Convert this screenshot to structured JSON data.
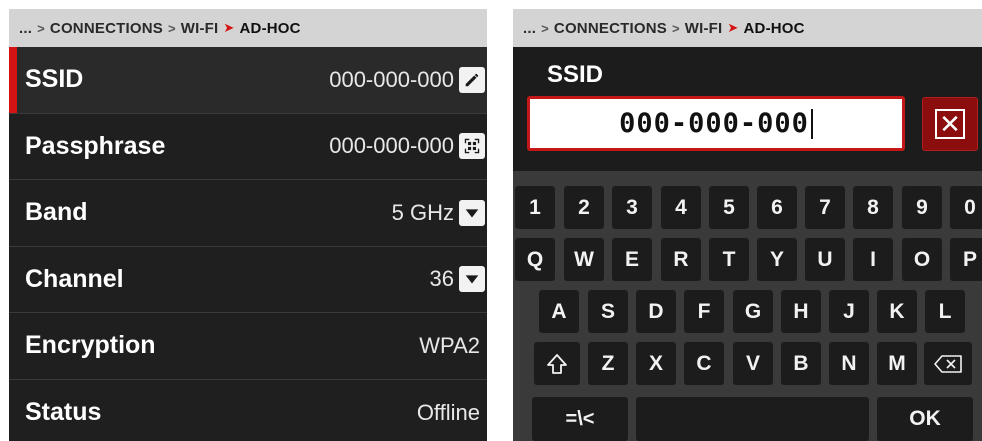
{
  "left": {
    "breadcrumb": {
      "ellipsis": "...",
      "connections": "CONNECTIONS",
      "wifi": "WI-FI",
      "current": "AD-HOC"
    },
    "rows": [
      {
        "label": "SSID",
        "value": "000-000-000",
        "icon": "pencil-icon"
      },
      {
        "label": "Passphrase",
        "value": "000-000-000",
        "icon": "qr-code-icon"
      },
      {
        "label": "Band",
        "value": "5 GHz",
        "icon": "dropdown-icon"
      },
      {
        "label": "Channel",
        "value": "36",
        "icon": "dropdown-icon"
      },
      {
        "label": "Encryption",
        "value": "WPA2"
      },
      {
        "label": "Status",
        "value": "Offline"
      }
    ]
  },
  "right": {
    "breadcrumb": {
      "ellipsis": "...",
      "connections": "CONNECTIONS",
      "wifi": "WI-FI",
      "current": "AD-HOC"
    },
    "field_label": "SSID",
    "field_value": "000-000-000",
    "clear_icon": "clear-icon",
    "keyboard": {
      "row1": [
        "1",
        "2",
        "3",
        "4",
        "5",
        "6",
        "7",
        "8",
        "9",
        "0"
      ],
      "row2": [
        "Q",
        "W",
        "E",
        "R",
        "T",
        "Y",
        "U",
        "I",
        "O",
        "P"
      ],
      "row3": [
        "A",
        "S",
        "D",
        "F",
        "G",
        "H",
        "J",
        "K",
        "L"
      ],
      "row4": [
        "Z",
        "X",
        "C",
        "V",
        "B",
        "N",
        "M"
      ],
      "shift_icon": "shift-icon",
      "backspace_icon": "backspace-icon",
      "symbols_label": "=\\<",
      "ok_label": "OK"
    }
  },
  "colors": {
    "accent": "#d41414",
    "panel": "#1f1f1f",
    "crumb_bg": "#d4d4d4"
  }
}
